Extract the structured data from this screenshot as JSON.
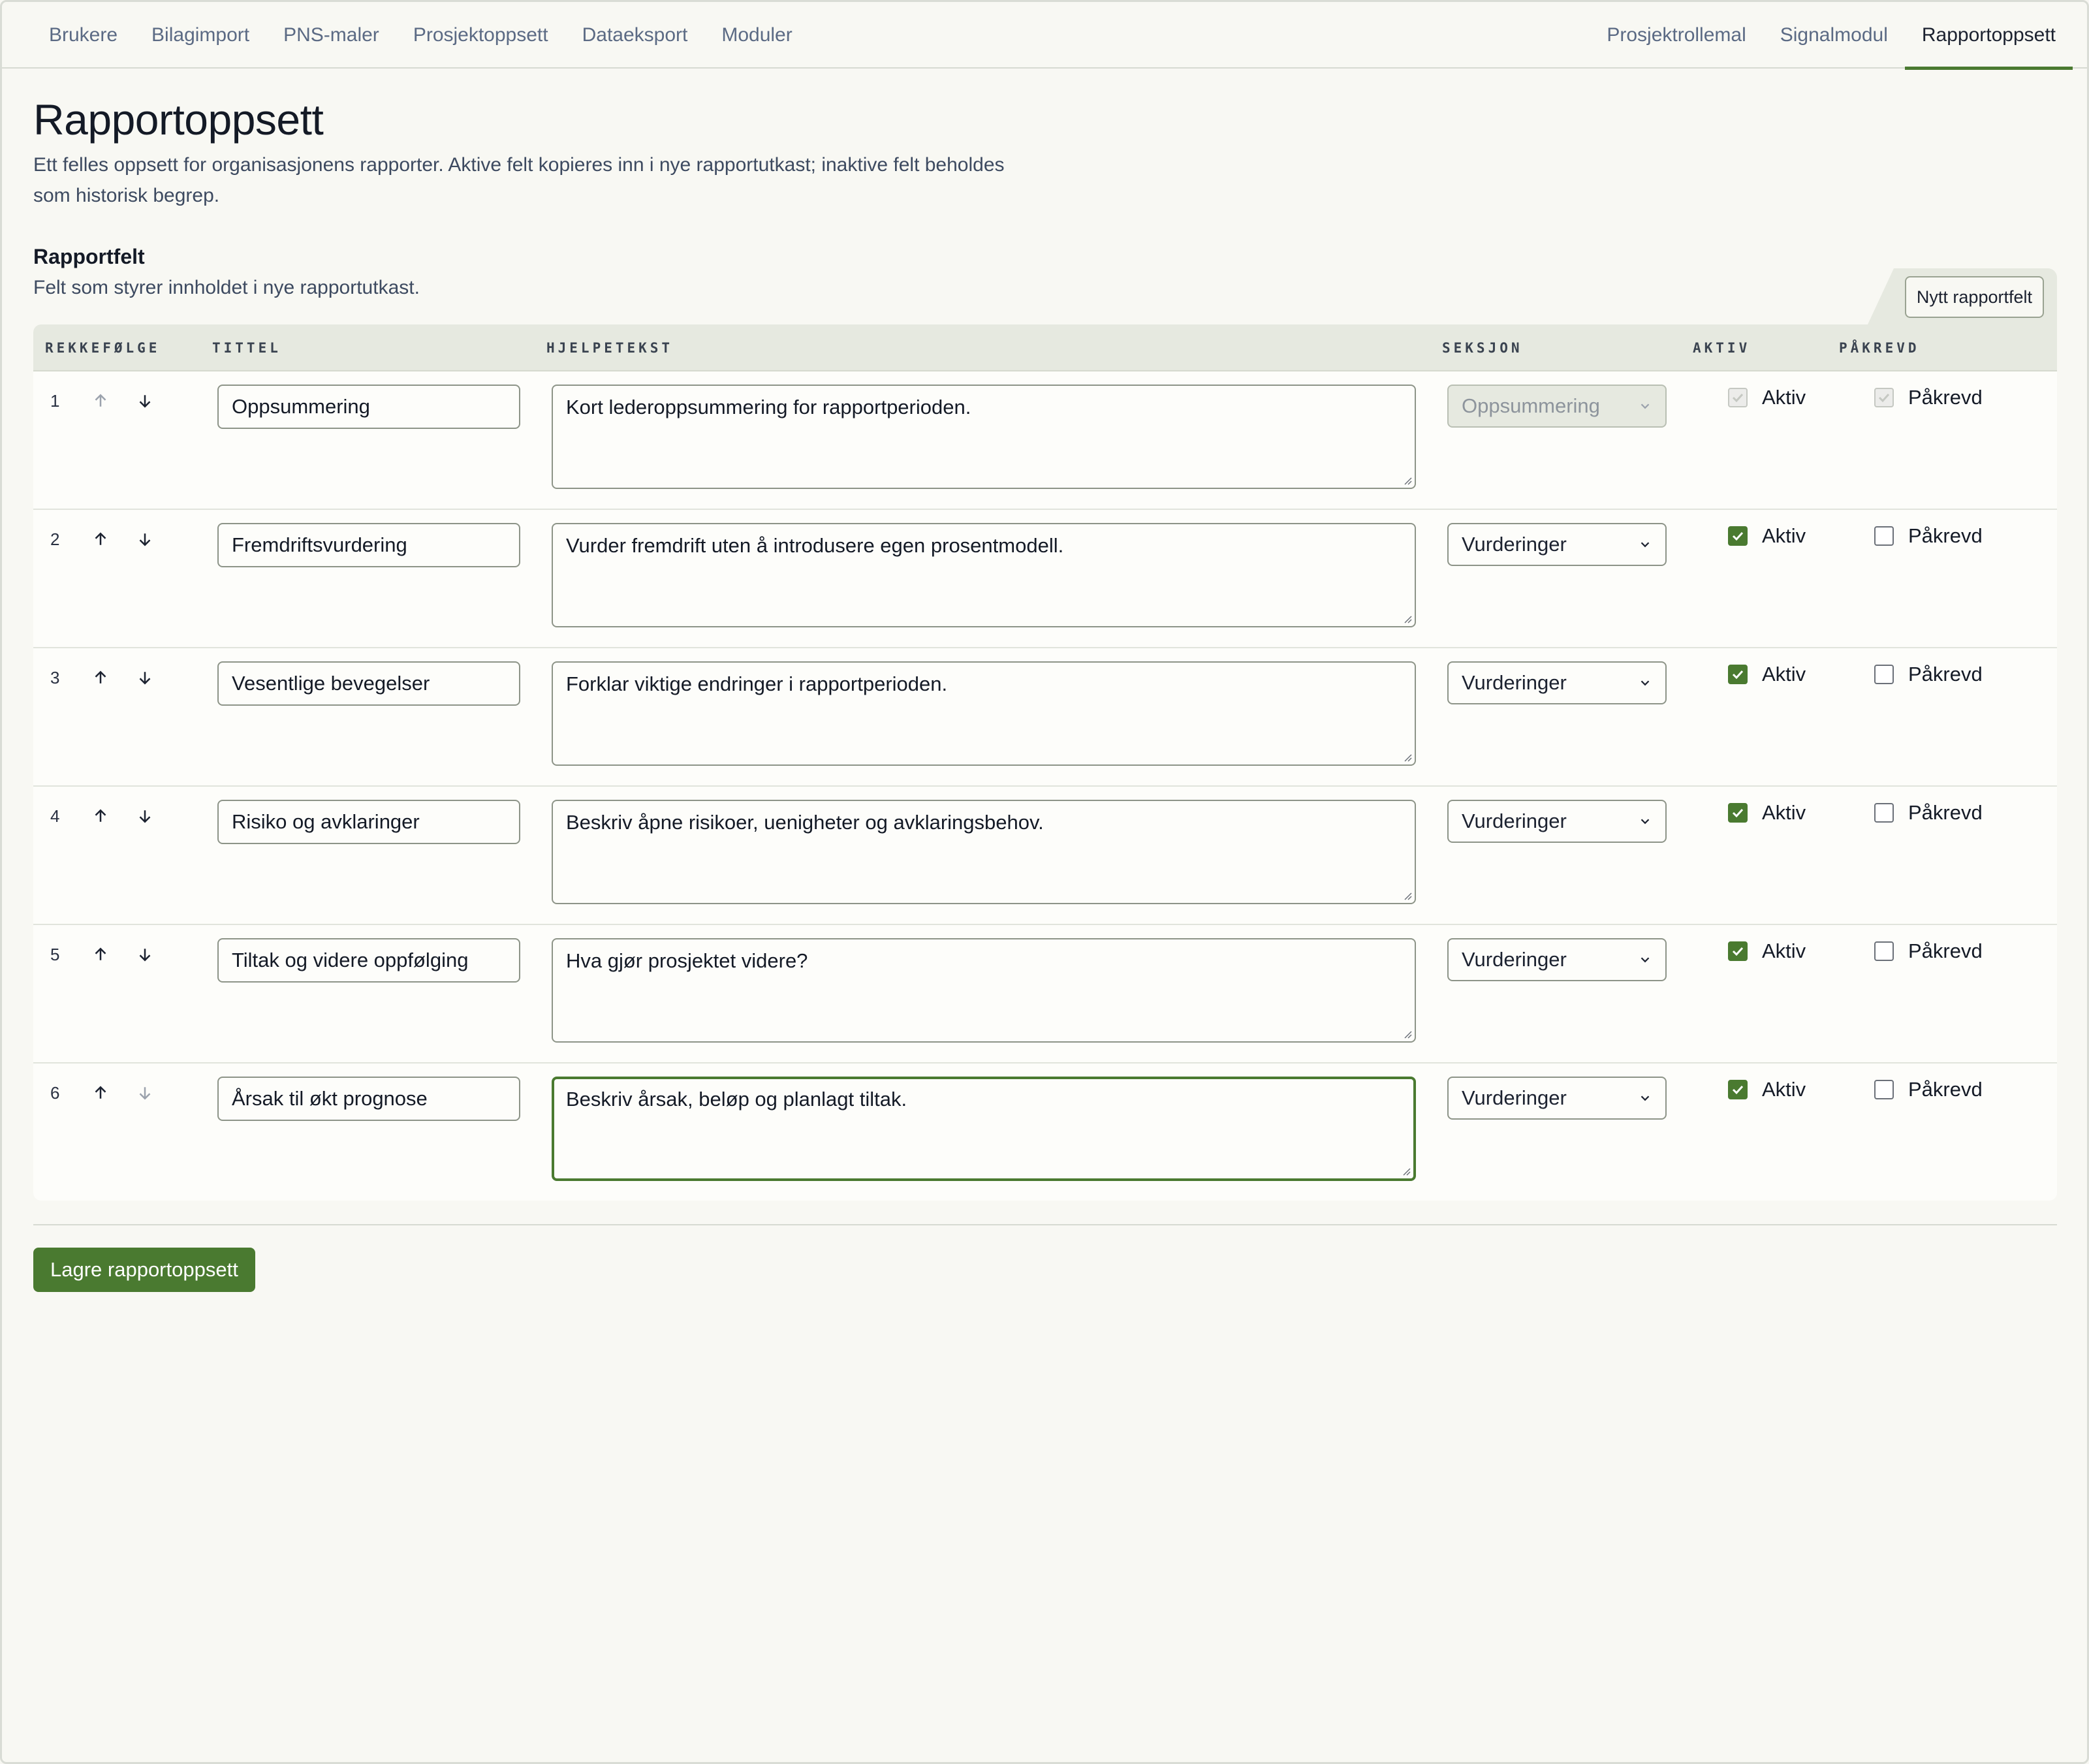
{
  "nav": {
    "left": [
      "Brukere",
      "Bilagimport",
      "PNS-maler",
      "Prosjektoppsett",
      "Dataeksport",
      "Moduler"
    ],
    "right": [
      "Prosjektrollemal",
      "Signalmodul",
      "Rapportoppsett"
    ]
  },
  "page": {
    "title": "Rapportoppsett",
    "intro": "Ett felles oppsett for organisasjonens rapporter. Aktive felt kopieres inn i nye rapportutkast; inaktive felt beholdes som historisk begrep."
  },
  "section": {
    "title": "Rapportfelt",
    "subtitle": "Felt som styrer innholdet i nye rapportutkast.",
    "new_button": "Nytt rapportfelt"
  },
  "table": {
    "headers": {
      "order": "REKKEFØLGE",
      "title": "TITTEL",
      "help": "HJELPETEKST",
      "section": "SEKSJON",
      "active": "AKTIV",
      "required": "PÅKREVD"
    },
    "active_label": "Aktiv",
    "required_label": "Påkrevd",
    "rows": [
      {
        "index": "1",
        "title": "Oppsummering",
        "help": "Kort lederoppsummering for rapportperioden.",
        "section": "Oppsummering"
      },
      {
        "index": "2",
        "title": "Fremdriftsvurdering",
        "help": "Vurder fremdrift uten å introdusere egen prosentmodell.",
        "section": "Vurderinger"
      },
      {
        "index": "3",
        "title": "Vesentlige bevegelser",
        "help": "Forklar viktige endringer i rapportperioden.",
        "section": "Vurderinger"
      },
      {
        "index": "4",
        "title": "Risiko og avklaringer",
        "help": "Beskriv åpne risikoer, uenigheter og avklaringsbehov.",
        "section": "Vurderinger"
      },
      {
        "index": "5",
        "title": "Tiltak og videre oppfølging",
        "help": "Hva gjør prosjektet videre?",
        "section": "Vurderinger"
      },
      {
        "index": "6",
        "title": "Årsak til økt prognose",
        "help": "Beskriv årsak, beløp og planlagt tiltak.",
        "section": "Vurderinger"
      }
    ]
  },
  "save_button": "Lagre rapportoppsett",
  "colors": {
    "accent": "#4a7a30",
    "background": "#f8f8f3",
    "header": "#e6e9e0"
  }
}
